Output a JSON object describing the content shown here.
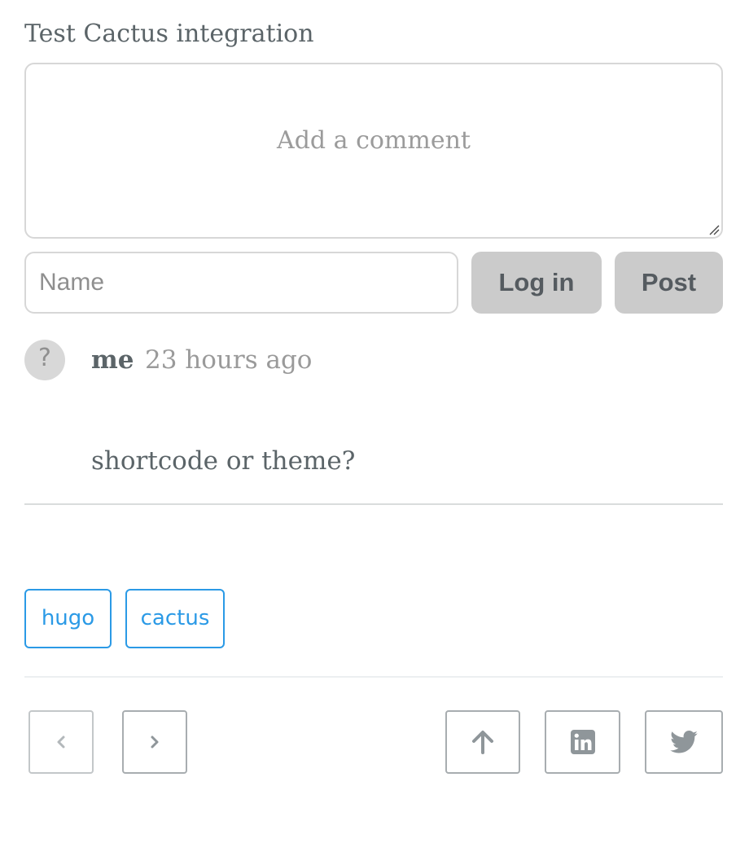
{
  "comments": {
    "section_title": "Test Cactus integration",
    "comment_placeholder": "Add a comment",
    "name_placeholder": "Name",
    "name_value": "",
    "login_label": "Log in",
    "post_label": "Post",
    "items": [
      {
        "avatar_glyph": "?",
        "author": "me",
        "time": "23 hours ago",
        "body": "shortcode or theme?"
      }
    ]
  },
  "tags": [
    {
      "label": "hugo"
    },
    {
      "label": "cactus"
    }
  ],
  "nav": {
    "icons": [
      "chevron-left-icon",
      "chevron-right-icon",
      "arrow-up-icon",
      "linkedin-icon",
      "twitter-icon"
    ]
  },
  "colors": {
    "accent": "#2b9ae6",
    "button_bg": "#cbcbcb",
    "text": "#5b6468",
    "muted": "#9a9a9a",
    "icon": "#a8adb0"
  }
}
